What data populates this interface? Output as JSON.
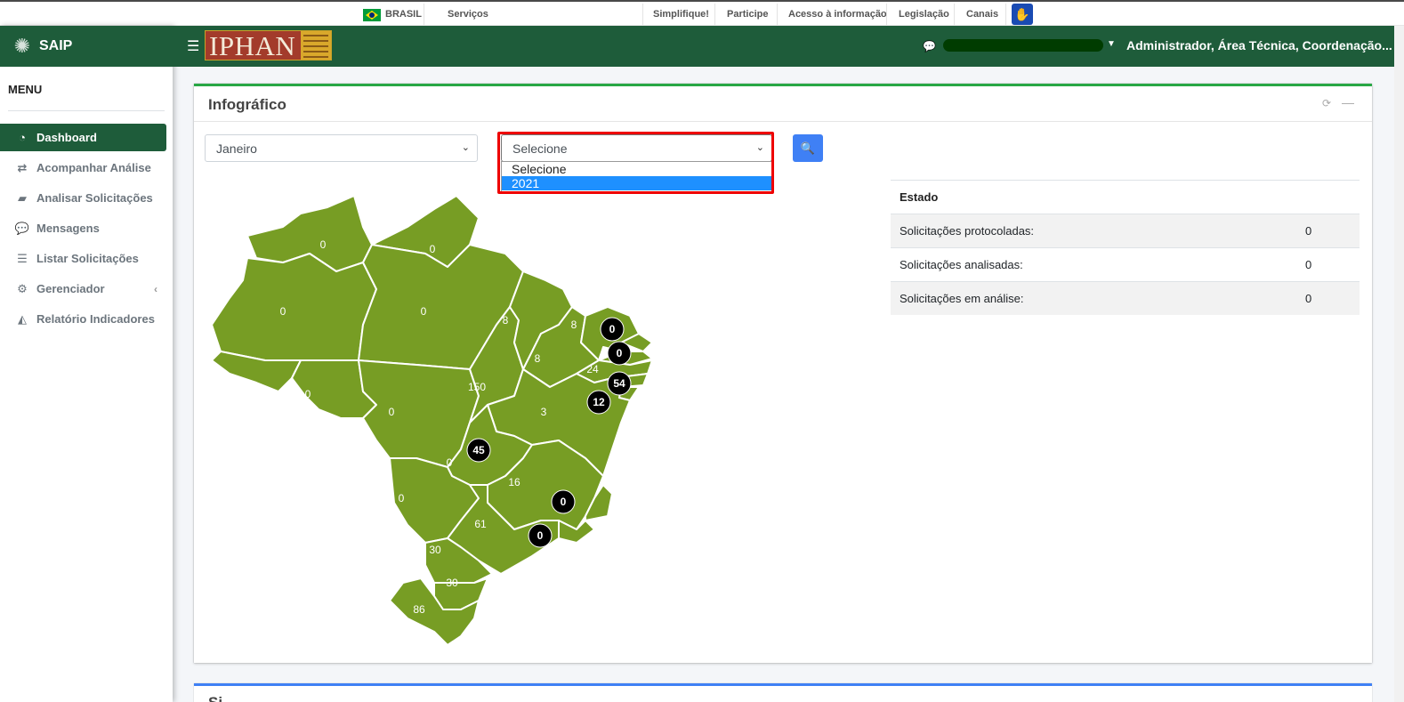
{
  "govbar": {
    "country": "BRASIL",
    "services": "Serviços",
    "links": [
      "Simplifique!",
      "Participe",
      "Acesso à informação",
      "Legislação",
      "Canais"
    ]
  },
  "sidebar": {
    "brand": "SAIP",
    "menu_title": "MENU",
    "items": [
      {
        "label": "Dashboard",
        "icon": "dashboard-icon",
        "active": true
      },
      {
        "label": "Acompanhar Análise",
        "icon": "exchange-icon"
      },
      {
        "label": "Analisar Solicitações",
        "icon": "book-icon"
      },
      {
        "label": "Mensagens",
        "icon": "chat-icon"
      },
      {
        "label": "Listar Solicitações",
        "icon": "list-icon"
      },
      {
        "label": "Gerenciador",
        "icon": "cogs-icon",
        "has_submenu": true
      },
      {
        "label": "Relatório Indicadores",
        "icon": "area-chart-icon"
      }
    ]
  },
  "header": {
    "logo_text": "IPHAN",
    "user_role": "Administrador, Área Técnica, Coordenação..."
  },
  "card": {
    "title": "Infográfico",
    "month_select": {
      "value": "Janeiro"
    },
    "year_select": {
      "value": "Selecione",
      "options": [
        "Selecione",
        "2021"
      ],
      "highlighted": "2021"
    }
  },
  "stats": {
    "header": "Estado",
    "rows": [
      {
        "label": "Solicitações protocoladas:",
        "value": "0"
      },
      {
        "label": "Solicitações analisadas:",
        "value": "0"
      },
      {
        "label": "Solicitações em análise:",
        "value": "0"
      }
    ]
  },
  "map": {
    "colors": {
      "region": "#779d24",
      "badge": "#000000"
    },
    "states": {
      "RR": "0",
      "AP": "0",
      "AM": "0",
      "PA": "0",
      "MA": "8",
      "PI": "8",
      "CE": "8",
      "AC": "0",
      "RO": "0",
      "MT": "0",
      "TO": "150",
      "BA": "3",
      "GO": "0",
      "MS": "0",
      "MG": "16",
      "SP": "61",
      "PR": "30",
      "SC": "30",
      "RS": "86",
      "PE": "24"
    },
    "badges": {
      "RN": "0",
      "PB": "0",
      "AL": "54",
      "SE": "12",
      "DF": "45",
      "ES": "0",
      "RJ": "0"
    }
  },
  "card2": {
    "title": "Si..."
  },
  "colors": {
    "primary_green": "#1e5c3a",
    "card_top": "#28a745",
    "button_blue": "#3f80f5",
    "highlight_red": "#ee0000"
  }
}
